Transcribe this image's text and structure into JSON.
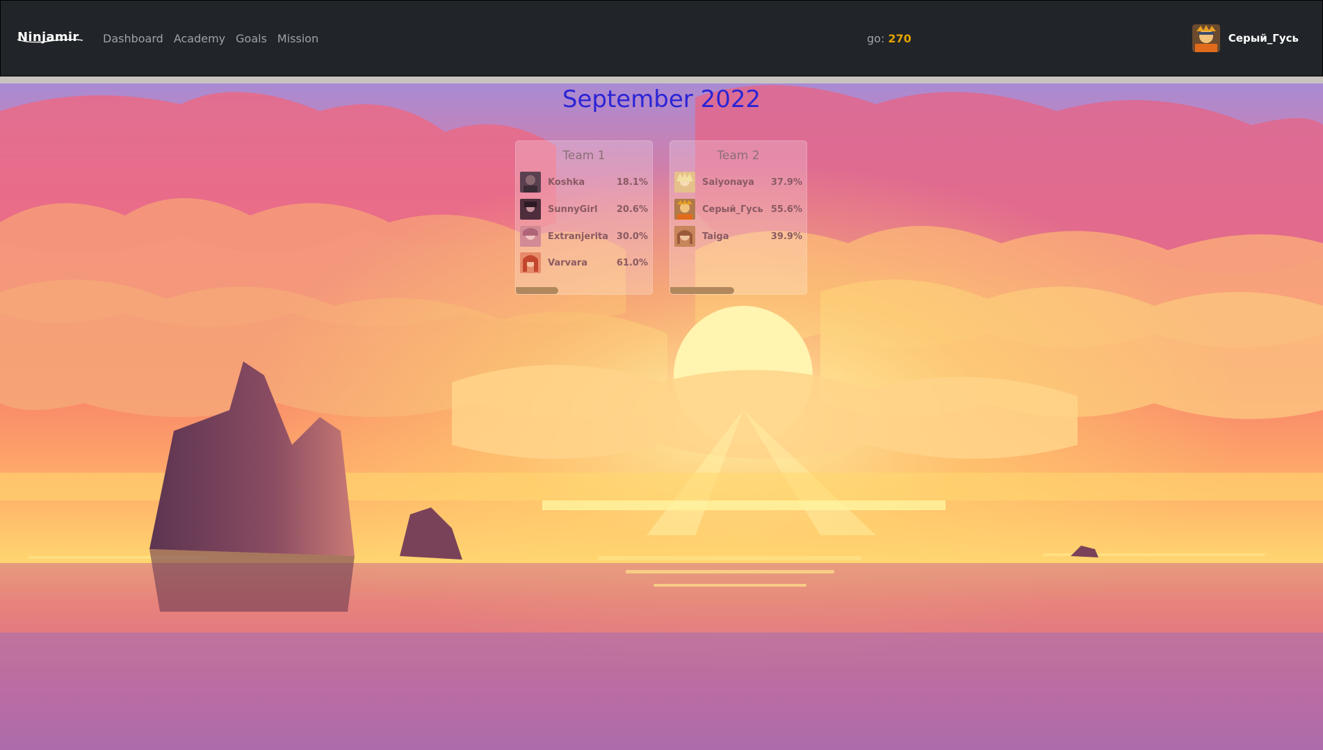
{
  "nav": {
    "brand": "Ninjamir",
    "links": [
      "Dashboard",
      "Academy",
      "Goals",
      "Mission"
    ],
    "currency_label": "go:",
    "currency_value": "270",
    "username": "Серый_Гусь"
  },
  "month_title": "September 2022",
  "teams": [
    {
      "name": "Team 1",
      "progress": 0.31,
      "members": [
        {
          "name": "Koshka",
          "pct": "18.1%"
        },
        {
          "name": "SunnyGirl",
          "pct": "20.6%"
        },
        {
          "name": "Extranjerita",
          "pct": "30.0%"
        },
        {
          "name": "Varvara",
          "pct": "61.0%"
        }
      ]
    },
    {
      "name": "Team 2",
      "progress": 0.47,
      "members": [
        {
          "name": "Saiyonaya",
          "pct": "37.9%"
        },
        {
          "name": "Серый_Гусь",
          "pct": "55.6%"
        },
        {
          "name": "Taiga",
          "pct": "39.9%"
        }
      ]
    }
  ],
  "colors": {
    "navbar_bg": "#212529",
    "accent_currency": "#e3a300",
    "month_title": "#2b24d6",
    "progress": "#b1885e"
  }
}
